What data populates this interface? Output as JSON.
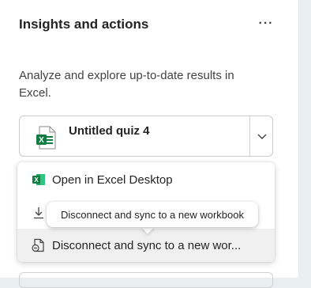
{
  "panel": {
    "title": "Insights and actions",
    "more_icon": "more-horizontal-icon",
    "description": "Analyze and explore up-to-date results in Excel."
  },
  "file_select": {
    "file_name": "Untitled quiz 4",
    "icon": "excel-file-icon",
    "chevron": "chevron-down-icon"
  },
  "menu": {
    "items": [
      {
        "label": "Open in Excel Desktop",
        "icon": "excel-icon"
      },
      {
        "label": "",
        "icon": "download-icon"
      },
      {
        "label": "Disconnect and sync to a new wor...",
        "icon": "disconnect-sync-icon"
      }
    ]
  },
  "tooltip": {
    "text": "Disconnect and sync to a new workbook"
  },
  "colors": {
    "excel_green": "#107c41",
    "hover_bg": "#f0f0f0",
    "text": "#242424"
  }
}
